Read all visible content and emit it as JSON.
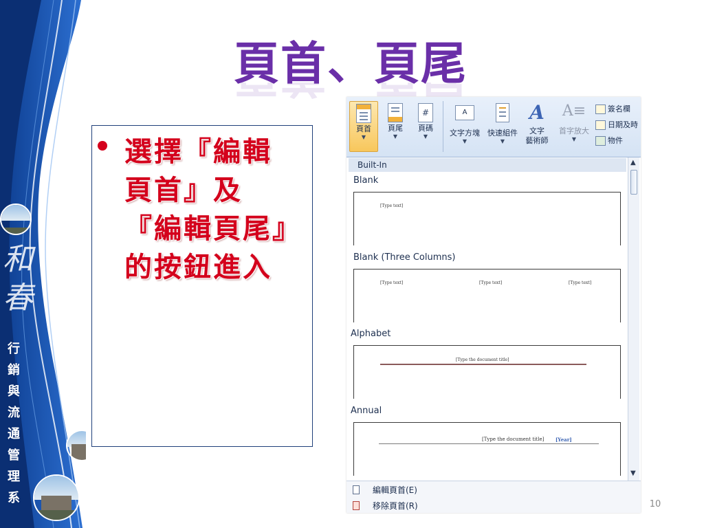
{
  "slide": {
    "title": "頁首、頁尾",
    "bullet": "選擇『編輯頁首』及『編輯頁尾』的按鈕進入",
    "page_number": "10"
  },
  "sidebar": {
    "department": "行銷與流通管理系",
    "calligraphy": "和春"
  },
  "ribbon": {
    "header_button": "頁首",
    "footer_button": "頁尾",
    "page_number_button": "頁碼",
    "textbox_button": "文字方塊",
    "quick_parts_button": "快速組件",
    "wordart_button_line1": "文字",
    "wordart_button_line2": "藝術師",
    "dropcap_button": "首字放大",
    "signature_line": "簽名欄",
    "date_time": "日期及時",
    "object": "物件"
  },
  "gallery": {
    "heading": "Built-In",
    "sections": [
      {
        "label": "Blank",
        "placeholders": [
          "[Type text]"
        ]
      },
      {
        "label": "Blank (Three Columns)",
        "placeholders": [
          "[Type text]",
          "[Type text]",
          "[Type text]"
        ]
      },
      {
        "label": "Alphabet",
        "placeholders": [
          "[Type the document title]"
        ]
      },
      {
        "label": "Annual",
        "placeholders": [
          "[Type the document title]",
          "[Year]"
        ]
      }
    ]
  },
  "menu": {
    "edit_header": "編輯頁首(E)",
    "remove_header": "移除頁首(R)"
  },
  "colors": {
    "title": "#6a2fa8",
    "bullet_text": "#d4001c",
    "band_blue": "#1b4fa8",
    "ribbon_bg": "#d5e3f4",
    "selected_button": "#f8c75c"
  },
  "icons": [
    "header-icon",
    "footer-icon",
    "page-number-icon",
    "textbox-icon",
    "quick-parts-icon",
    "wordart-icon",
    "dropcap-icon",
    "signature-icon",
    "datetime-icon",
    "object-icon",
    "scroll-up-icon",
    "scroll-down-icon",
    "edit-header-icon",
    "remove-header-icon"
  ]
}
